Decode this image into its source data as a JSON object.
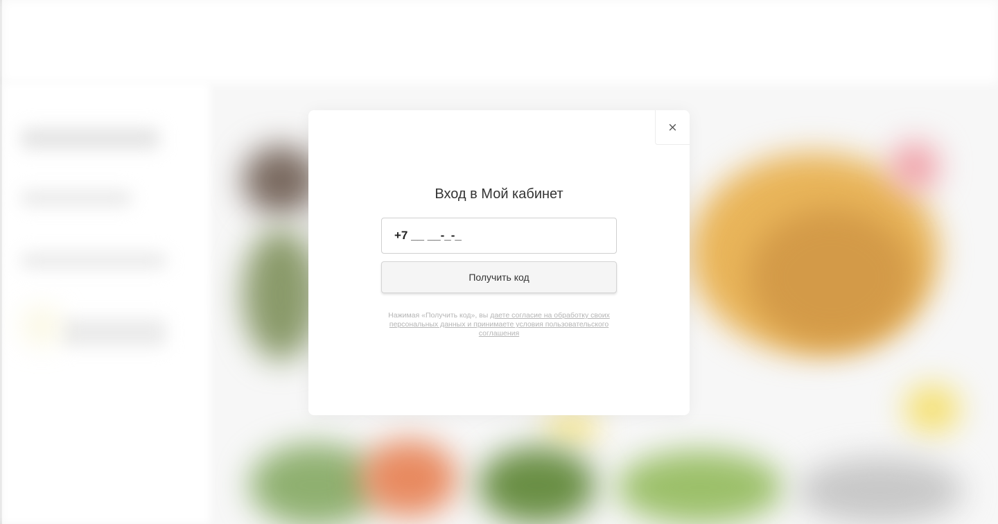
{
  "modal": {
    "close_icon": "×",
    "title": "Вход в Мой кабинет",
    "phone_value": "+7 __ __-_-_",
    "submit_label": "Получить код",
    "consent_prefix": "Нажимая «Получить код», вы ",
    "consent_link": "даете согласие на обработку своих персональных данных и принимаете условия пользовательского соглашения"
  }
}
